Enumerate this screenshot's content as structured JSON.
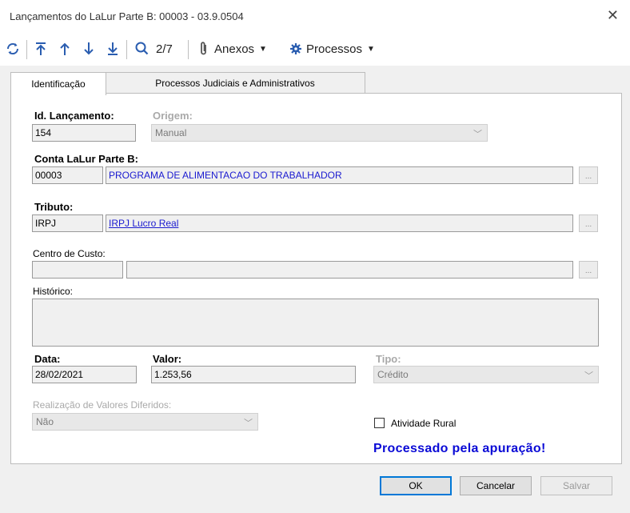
{
  "window": {
    "title": "Lançamentos do LaLur Parte B: 00003 - 03.9.0504"
  },
  "toolbar": {
    "icons": [
      "refresh-icon",
      "first-record-icon",
      "previous-record-icon",
      "next-record-icon",
      "last-record-icon",
      "search-icon",
      "paperclip-icon",
      "gear-icon"
    ],
    "record_position": "2/7",
    "anexos_label": "Anexos",
    "processos_label": "Processos"
  },
  "tabs": [
    {
      "label": "Identificação",
      "active": true
    },
    {
      "label": "Processos Judiciais e Administrativos",
      "active": false
    }
  ],
  "form": {
    "id_lancamento": {
      "label": "Id. Lançamento:",
      "value": "154"
    },
    "origem": {
      "label": "Origem:",
      "value": "Manual"
    },
    "conta": {
      "label": "Conta LaLur Parte B:",
      "code": "00003",
      "description": "PROGRAMA DE ALIMENTACAO DO TRABALHADOR"
    },
    "tributo": {
      "label": "Tributo:",
      "code": "IRPJ",
      "description": "IRPJ Lucro Real"
    },
    "centro_custo": {
      "label": "Centro de Custo:",
      "code": "",
      "description": ""
    },
    "historico": {
      "label": "Histórico:",
      "value": ""
    },
    "data": {
      "label": "Data:",
      "value": "28/02/2021"
    },
    "valor": {
      "label": "Valor:",
      "value": "1.253,56"
    },
    "tipo": {
      "label": "Tipo:",
      "value": "Crédito"
    },
    "realizacao": {
      "label": "Realização de Valores Diferidos:",
      "value": "Não"
    },
    "atividade_rural": {
      "label": "Atividade Rural",
      "checked": false
    },
    "lookup_button": "...",
    "status_message": "Processado pela apuração!"
  },
  "buttons": {
    "ok": "OK",
    "cancel": "Cancelar",
    "save": "Salvar"
  },
  "colors": {
    "link": "#1a1ad0",
    "status": "#0a0ad6",
    "default_button_border": "#0078d7",
    "toolbar_icon": "#2a5db0"
  }
}
